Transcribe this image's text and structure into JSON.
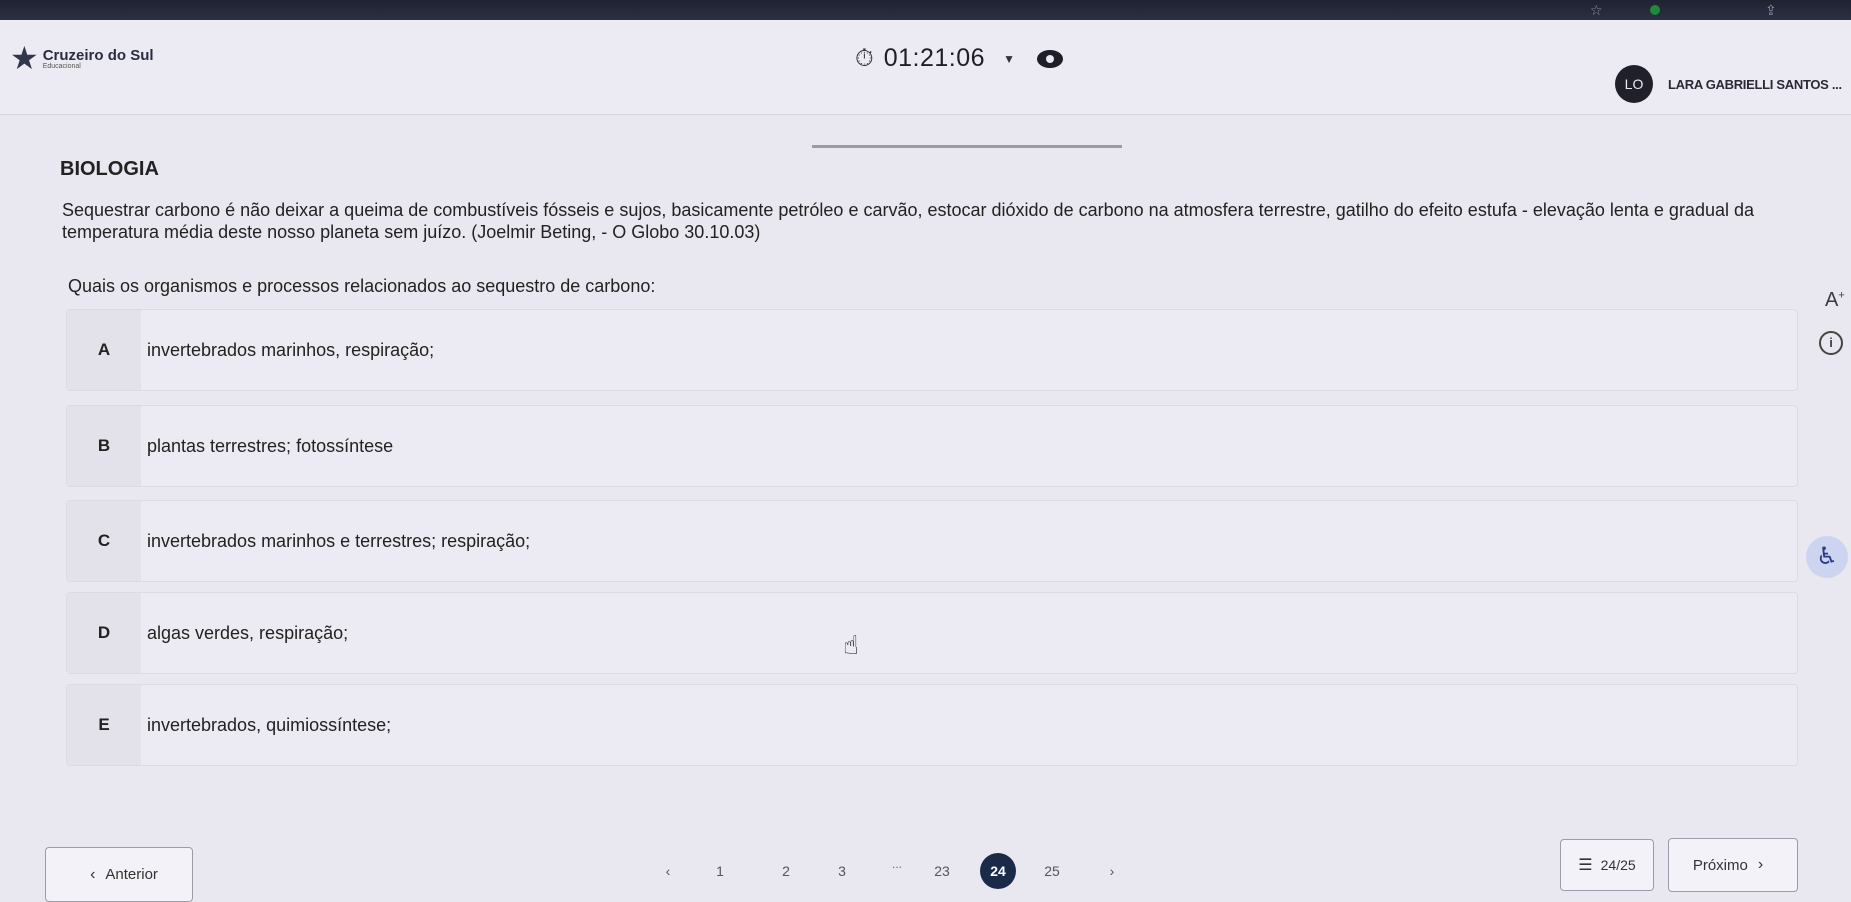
{
  "browser": {
    "star_icon": "☆",
    "extension_icon": "green-extension-icon",
    "share_icon": "share-icon"
  },
  "header": {
    "brand_name": "Cruzeiro do Sul",
    "brand_sub": "Educacional",
    "timer": "01:21:06",
    "user_initials": "LO",
    "user_name": "LARA GABRIELLI SANTOS ..."
  },
  "content": {
    "subject": "BIOLOGIA",
    "context": "Sequestrar carbono é não deixar a queima de combustíveis fósseis e sujos, basicamente petróleo e carvão, estocar dióxido de carbono na atmosfera terrestre, gatilho do efeito estufa - elevação lenta e gradual da temperatura média deste nosso planeta sem juízo. (Joelmir Beting, - O Globo 30.10.03)",
    "question": "Quais os organismos e processos relacionados ao sequestro de carbono:",
    "options": [
      {
        "letter": "A",
        "text": "invertebrados marinhos, respiração;"
      },
      {
        "letter": "B",
        "text": "plantas terrestres; fotossíntese"
      },
      {
        "letter": "C",
        "text": "invertebrados marinhos e terrestres; respiração;"
      },
      {
        "letter": "D",
        "text": "algas verdes, respiração;"
      },
      {
        "letter": "E",
        "text": "invertebrados, quimiossíntese;"
      }
    ]
  },
  "footer": {
    "prev_label": "Anterior",
    "next_label": "Próximo",
    "pages": [
      "1",
      "2",
      "3",
      "23",
      "24",
      "25"
    ],
    "ellipsis": "...",
    "active_page": "24",
    "counter": "24/25"
  }
}
